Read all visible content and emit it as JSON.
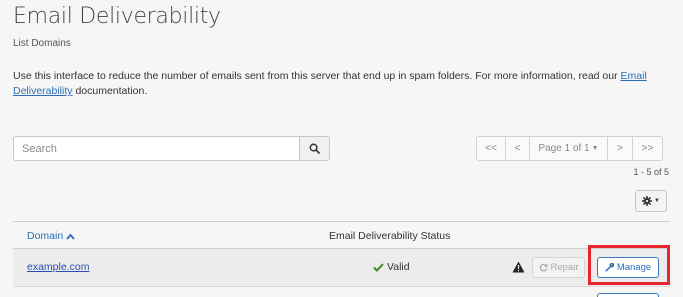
{
  "header": {
    "title": "Email Deliverability",
    "subtitle": "List Domains"
  },
  "description": {
    "text_before": "Use this interface to reduce the number of emails sent from this server that end up in spam folders. For more information, read our ",
    "link_text": "Email Deliverability",
    "text_after": " documentation."
  },
  "search": {
    "placeholder": "Search",
    "value": "",
    "button_icon": "search-icon"
  },
  "pagination": {
    "first": "<<",
    "prev": "<",
    "page_label": "Page 1 of 1",
    "next": ">",
    "last": ">>"
  },
  "range_text": "1 - 5 of 5",
  "settings": {
    "icon": "gear-icon"
  },
  "table": {
    "columns": [
      {
        "label": "Domain",
        "sort": "ascending"
      },
      {
        "label": "Email Deliverability Status"
      }
    ],
    "rows": [
      {
        "domain": "example.com",
        "status": "Valid",
        "status_icon": "check-icon",
        "warning_icon": "warning-icon",
        "repair_label": "Repair",
        "repair_enabled": false,
        "manage_label": "Manage"
      }
    ]
  },
  "colors": {
    "link": "#2a6fb8",
    "valid_check": "#3c8a2e",
    "highlight": "#e8262d"
  }
}
